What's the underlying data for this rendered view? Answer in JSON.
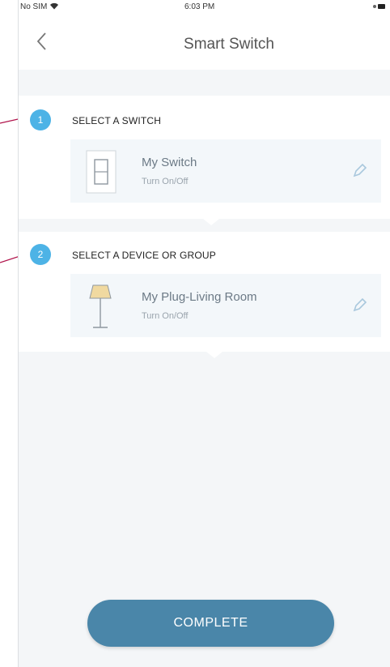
{
  "status_bar": {
    "carrier": "No SIM",
    "time": "6:03 PM"
  },
  "nav": {
    "title": "Smart Switch"
  },
  "step1": {
    "number": "1",
    "label": "SELECT A SWITCH",
    "device": {
      "name": "My Switch",
      "action": "Turn On/Off",
      "icon": "switch-icon"
    }
  },
  "step2": {
    "number": "2",
    "label": "SELECT A DEVICE OR GROUP",
    "device": {
      "name": "My Plug-Living Room",
      "action": "Turn On/Off",
      "icon": "lamp-icon"
    }
  },
  "complete_label": "COMPLETE",
  "colors": {
    "accent": "#4db3e6",
    "button": "#4a86a9",
    "callout": "#b0124a"
  }
}
